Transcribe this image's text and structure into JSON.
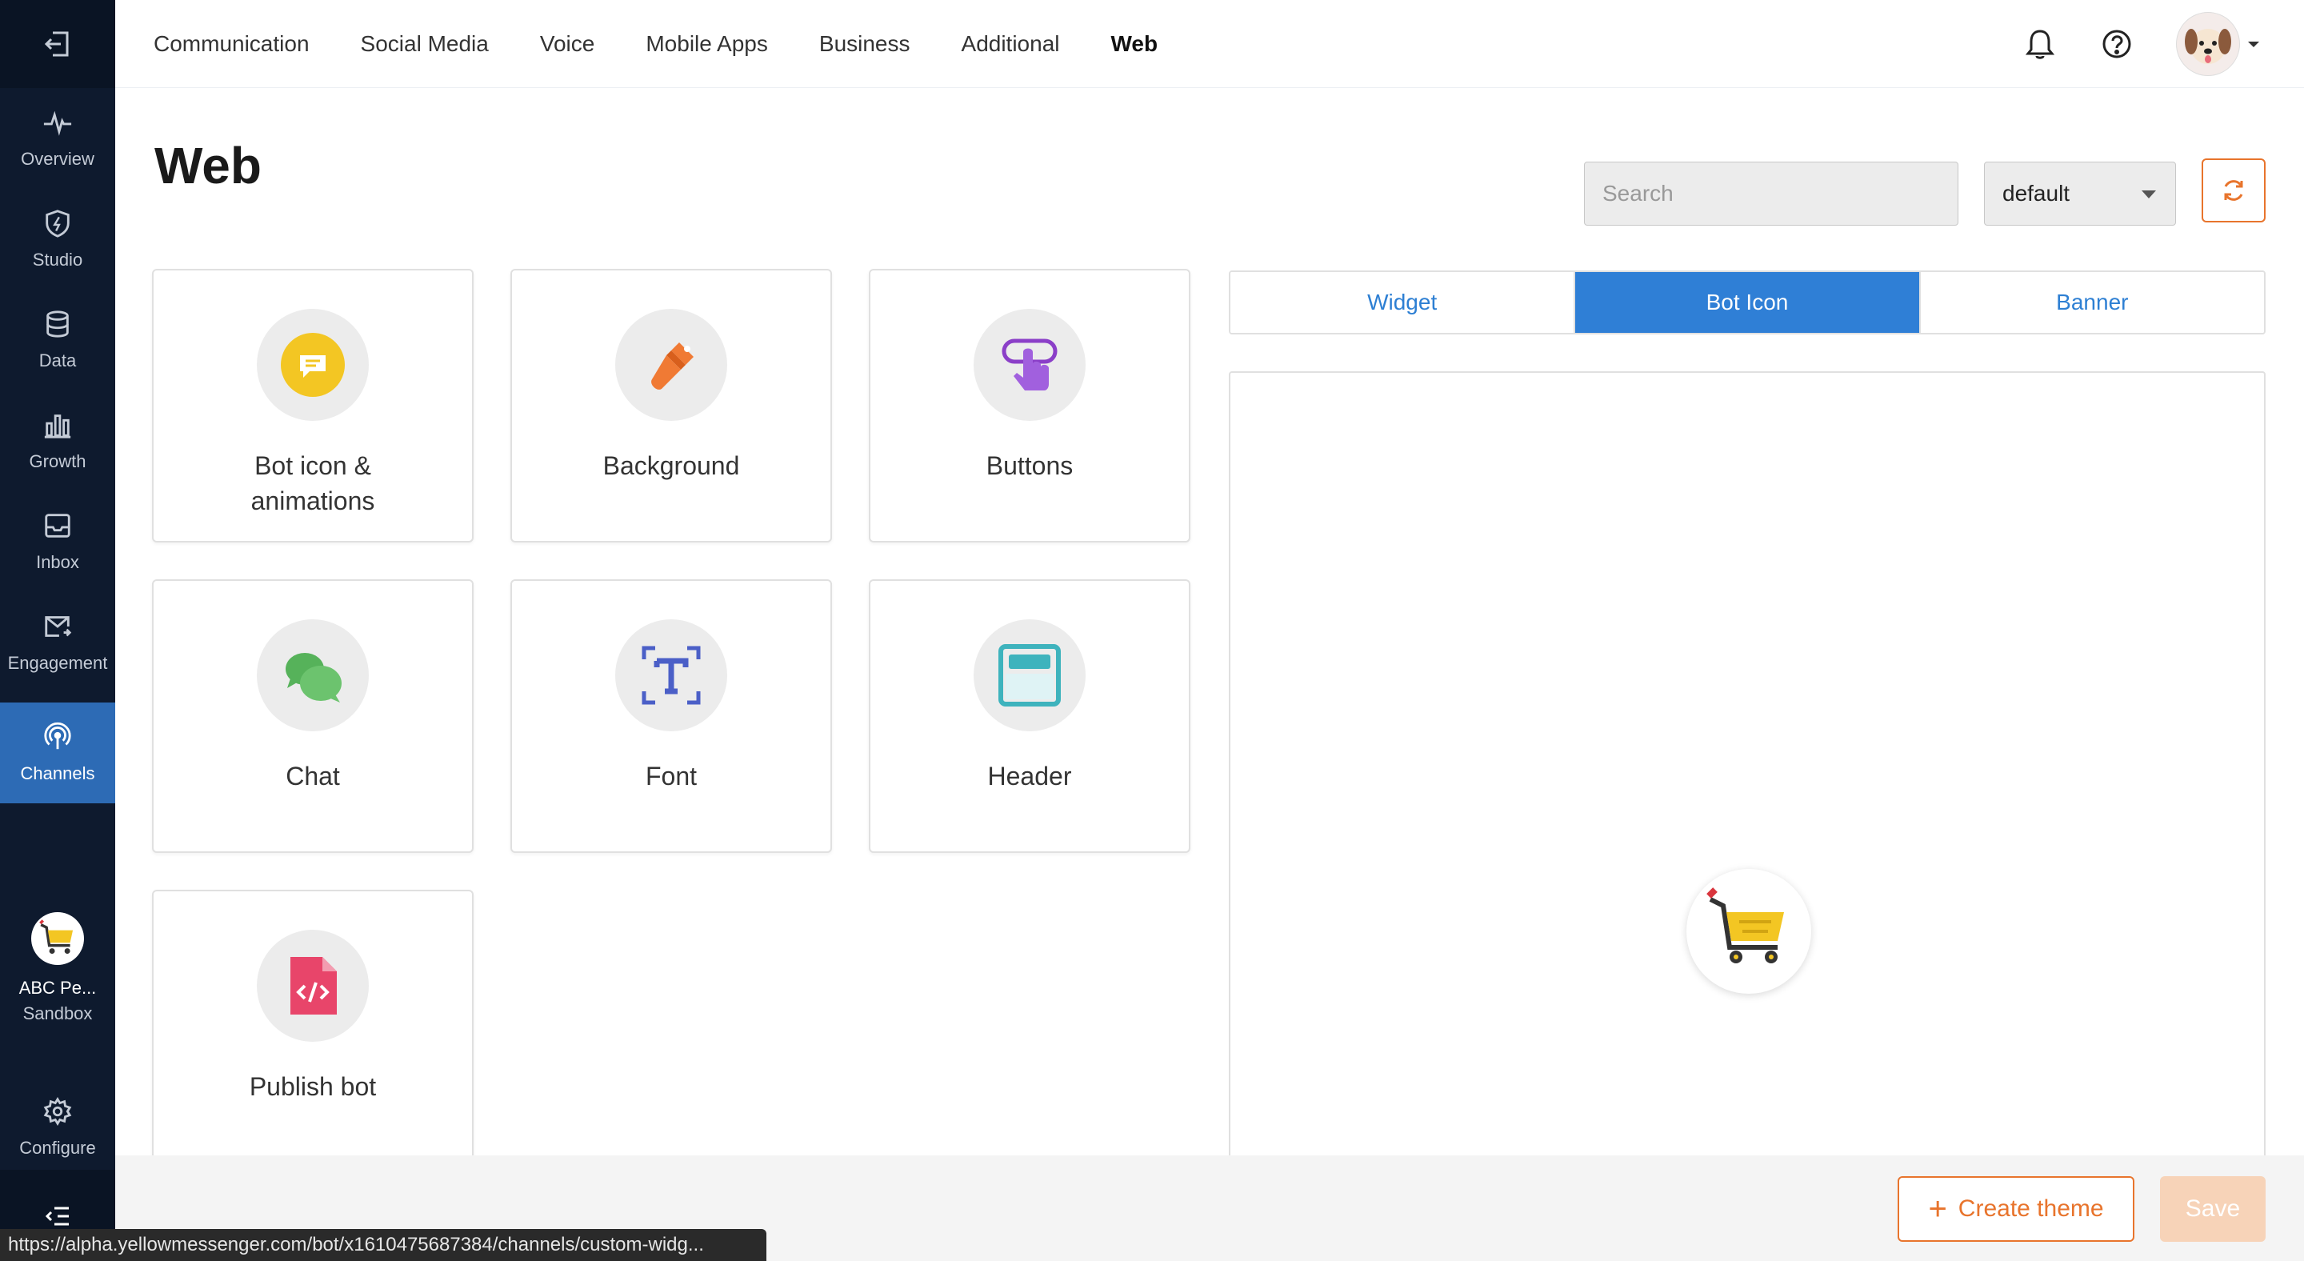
{
  "sidebar": {
    "items": [
      {
        "label": "Overview",
        "icon": "pulse-icon"
      },
      {
        "label": "Studio",
        "icon": "shield-bolt-icon"
      },
      {
        "label": "Data",
        "icon": "database-icon"
      },
      {
        "label": "Growth",
        "icon": "bar-chart-icon"
      },
      {
        "label": "Inbox",
        "icon": "inbox-icon"
      },
      {
        "label": "Engagement",
        "icon": "mail-icon"
      },
      {
        "label": "Channels",
        "icon": "broadcast-icon"
      }
    ],
    "bot": {
      "name": "ABC Pe...",
      "env": "Sandbox"
    },
    "configure": "Configure"
  },
  "topnav": {
    "tabs": [
      "Communication",
      "Social Media",
      "Voice",
      "Mobile Apps",
      "Business",
      "Additional",
      "Web"
    ],
    "active": "Web"
  },
  "page": {
    "title": "Web",
    "search_placeholder": "Search",
    "theme_select": "default"
  },
  "cards": [
    {
      "label": "Bot icon & animations",
      "icon": "chat-bubble-icon"
    },
    {
      "label": "Background",
      "icon": "paint-brush-icon"
    },
    {
      "label": "Buttons",
      "icon": "pointer-hand-icon"
    },
    {
      "label": "Chat",
      "icon": "chat-bubbles-icon"
    },
    {
      "label": "Font",
      "icon": "font-icon"
    },
    {
      "label": "Header",
      "icon": "header-window-icon"
    },
    {
      "label": "Publish bot",
      "icon": "code-file-icon"
    }
  ],
  "preview_tabs": {
    "tabs": [
      "Widget",
      "Bot Icon",
      "Banner"
    ],
    "active": "Bot Icon"
  },
  "footer": {
    "create_theme": "Create theme",
    "save": "Save"
  },
  "statusbar": {
    "url": "https://alpha.yellowmessenger.com/bot/x1610475687384/channels/custom-widg..."
  },
  "colors": {
    "sidebar_bg": "#0e1a2e",
    "sidebar_active": "#2d6bb5",
    "accent_orange": "#e8742c",
    "tab_blue": "#2f7fd6"
  }
}
